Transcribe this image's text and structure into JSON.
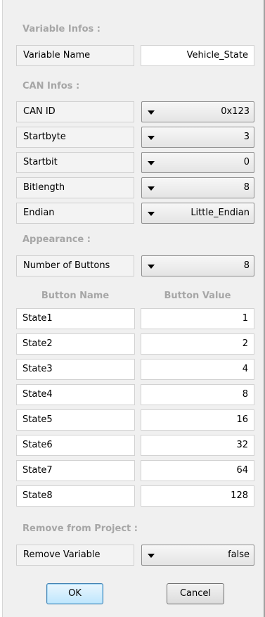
{
  "variable_infos": {
    "title": "Variable Infos :",
    "name_label": "Variable Name",
    "name_value": "Vehicle_State"
  },
  "can_infos": {
    "title": "CAN Infos :",
    "fields": [
      {
        "label": "CAN ID",
        "value": "0x123"
      },
      {
        "label": "Startbyte",
        "value": "3"
      },
      {
        "label": "Startbit",
        "value": "0"
      },
      {
        "label": "Bitlength",
        "value": "8"
      },
      {
        "label": "Endian",
        "value": "Little_Endian"
      }
    ]
  },
  "appearance": {
    "title": "Appearance :",
    "buttons_label": "Number of Buttons",
    "buttons_value": "8",
    "col_name": "Button Name",
    "col_value": "Button Value",
    "rows": [
      {
        "name": "State1",
        "value": "1"
      },
      {
        "name": "State2",
        "value": "2"
      },
      {
        "name": "State3",
        "value": "4"
      },
      {
        "name": "State4",
        "value": "8"
      },
      {
        "name": "State5",
        "value": "16"
      },
      {
        "name": "State6",
        "value": "32"
      },
      {
        "name": "State7",
        "value": "64"
      },
      {
        "name": "State8",
        "value": "128"
      }
    ]
  },
  "remove": {
    "title": "Remove from Project :",
    "label": "Remove Variable",
    "value": "false"
  },
  "footer": {
    "ok_label": "OK",
    "cancel_label": "Cancel"
  }
}
